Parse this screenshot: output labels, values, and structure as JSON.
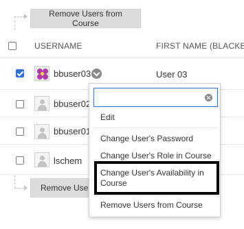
{
  "actions": {
    "remove_users_label": "Remove Users from Course",
    "remove_users_label_truncated": "Remove Users"
  },
  "table": {
    "columns": {
      "username": "USERNAME",
      "first_name": "FIRST NAME (BLACKBOA"
    },
    "rows": [
      {
        "username": "bbuser03",
        "first_name": "User 03",
        "checked": true,
        "avatar": "flower-avatar"
      },
      {
        "username": "bbuser02",
        "first_name": "",
        "checked": false,
        "avatar": "default-avatar"
      },
      {
        "username": "bbuser01",
        "first_name": "",
        "checked": false,
        "avatar": "default-avatar"
      },
      {
        "username": "lschem",
        "first_name": "",
        "checked": false,
        "avatar": "default-avatar"
      }
    ]
  },
  "context_menu": {
    "search_placeholder": "",
    "items": [
      "Edit",
      "Change User's Password",
      "Change User's Role in Course",
      "Change User's Availability in Course",
      "Remove Users from Course"
    ]
  },
  "colors": {
    "accent": "#2f6fd1",
    "highlight_border": "#000000",
    "button_bg": "#dcdcdc"
  }
}
